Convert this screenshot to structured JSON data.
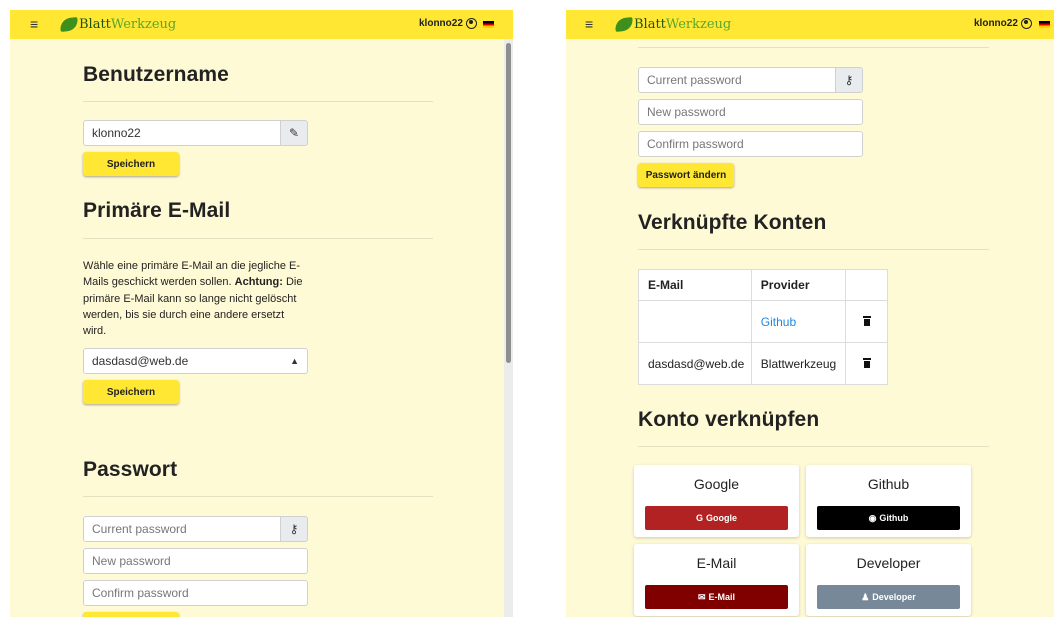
{
  "header": {
    "menu_icon": "hamburger-icon",
    "logo_blatt": "Blatt",
    "logo_werkzeug": "Werkzeug",
    "username": "klonno22",
    "user_icon": "user-circle-icon",
    "language_flag": "german-flag-icon"
  },
  "colors": {
    "background": "#fffad6",
    "topbar": "#ffe733",
    "button_primary": "#ffe733",
    "google": "#b22222",
    "github": "#000000",
    "email": "#800000",
    "developer": "#778899",
    "link": "#1e88e5"
  },
  "username_section": {
    "title": "Benutzername",
    "input_value": "klonno22",
    "edit_icon": "pencil-icon",
    "save_label": "Speichern"
  },
  "email_section": {
    "title": "Primäre E-Mail",
    "text_normal": "Wähle eine primäre E-Mail an die jegliche E-Mails geschickt werden sollen.",
    "text_bold": "Achtung:",
    "text_after": "Die primäre E-Mail kann so lange nicht gelöscht werden, bis sie durch eine andere ersetzt wird.",
    "selected_email": "dasdasd@web.de",
    "save_label": "Speichern"
  },
  "password_section": {
    "title": "Passwort",
    "current_placeholder": "Current password",
    "new_placeholder": "New password",
    "confirm_placeholder": "Confirm password",
    "key_icon": "key-icon",
    "change_label": "Passwort ändern"
  },
  "linked_accounts": {
    "title": "Verknüpfte Konten",
    "headers": [
      "E-Mail",
      "Provider",
      ""
    ],
    "rows": [
      {
        "email": "",
        "provider": "Github",
        "action_icon": "trash-icon"
      },
      {
        "email": "dasdasd@web.de",
        "provider": "Blattwerkzeug",
        "action_icon": "trash-icon"
      }
    ]
  },
  "link_account": {
    "title": "Konto verknüpfen",
    "providers": [
      {
        "title": "Google",
        "button": "Google",
        "icon": "google-icon"
      },
      {
        "title": "Github",
        "button": "Github",
        "icon": "github-icon"
      },
      {
        "title": "E-Mail",
        "button": "E-Mail",
        "icon": "envelope-icon"
      },
      {
        "title": "Developer",
        "button": "Developer",
        "icon": "user-icon"
      }
    ]
  }
}
